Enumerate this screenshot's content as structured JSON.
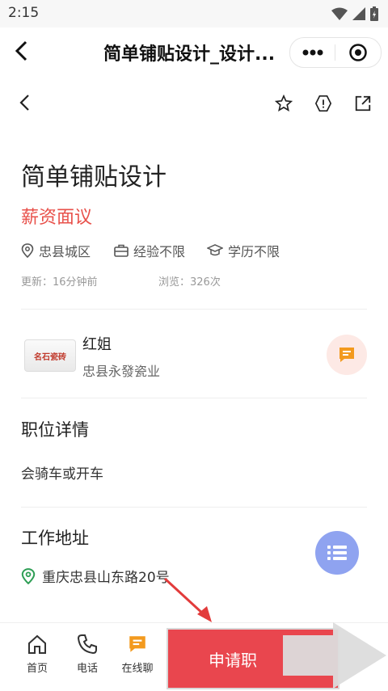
{
  "status_bar": {
    "time": "2:15"
  },
  "mini_bar": {
    "title": "简单铺贴设计_设计..."
  },
  "job": {
    "title": "简单铺贴设计",
    "salary": "薪资面议",
    "location": "忠县城区",
    "experience": "经验不限",
    "education": "学历不限",
    "updated": "更新：16分钟前",
    "views": "浏览：326次"
  },
  "contact": {
    "logo_text": "名石瓷砖",
    "name": "红姐",
    "company": "忠县永發瓷业"
  },
  "details": {
    "heading": "职位详情",
    "text": "会骑车或开车"
  },
  "work_address": {
    "heading": "工作地址",
    "address": "重庆忠县山东路20号"
  },
  "bottom_bar": {
    "home": "首页",
    "phone": "电话",
    "chat": "在线聊",
    "apply": "申请职"
  },
  "colors": {
    "salary": "#e8504a",
    "apply": "#e9464e",
    "chat_icon": "#f39a1e",
    "fab": "#8fa3f0",
    "location_pin": "#2e9e55"
  }
}
